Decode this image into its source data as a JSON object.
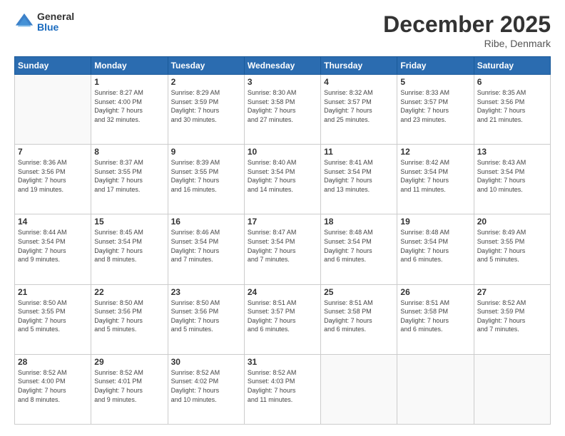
{
  "logo": {
    "general": "General",
    "blue": "Blue"
  },
  "header": {
    "month": "December 2025",
    "location": "Ribe, Denmark"
  },
  "days": [
    "Sunday",
    "Monday",
    "Tuesday",
    "Wednesday",
    "Thursday",
    "Friday",
    "Saturday"
  ],
  "weeks": [
    [
      {
        "day": "",
        "content": ""
      },
      {
        "day": "1",
        "content": "Sunrise: 8:27 AM\nSunset: 4:00 PM\nDaylight: 7 hours\nand 32 minutes."
      },
      {
        "day": "2",
        "content": "Sunrise: 8:29 AM\nSunset: 3:59 PM\nDaylight: 7 hours\nand 30 minutes."
      },
      {
        "day": "3",
        "content": "Sunrise: 8:30 AM\nSunset: 3:58 PM\nDaylight: 7 hours\nand 27 minutes."
      },
      {
        "day": "4",
        "content": "Sunrise: 8:32 AM\nSunset: 3:57 PM\nDaylight: 7 hours\nand 25 minutes."
      },
      {
        "day": "5",
        "content": "Sunrise: 8:33 AM\nSunset: 3:57 PM\nDaylight: 7 hours\nand 23 minutes."
      },
      {
        "day": "6",
        "content": "Sunrise: 8:35 AM\nSunset: 3:56 PM\nDaylight: 7 hours\nand 21 minutes."
      }
    ],
    [
      {
        "day": "7",
        "content": "Sunrise: 8:36 AM\nSunset: 3:56 PM\nDaylight: 7 hours\nand 19 minutes."
      },
      {
        "day": "8",
        "content": "Sunrise: 8:37 AM\nSunset: 3:55 PM\nDaylight: 7 hours\nand 17 minutes."
      },
      {
        "day": "9",
        "content": "Sunrise: 8:39 AM\nSunset: 3:55 PM\nDaylight: 7 hours\nand 16 minutes."
      },
      {
        "day": "10",
        "content": "Sunrise: 8:40 AM\nSunset: 3:54 PM\nDaylight: 7 hours\nand 14 minutes."
      },
      {
        "day": "11",
        "content": "Sunrise: 8:41 AM\nSunset: 3:54 PM\nDaylight: 7 hours\nand 13 minutes."
      },
      {
        "day": "12",
        "content": "Sunrise: 8:42 AM\nSunset: 3:54 PM\nDaylight: 7 hours\nand 11 minutes."
      },
      {
        "day": "13",
        "content": "Sunrise: 8:43 AM\nSunset: 3:54 PM\nDaylight: 7 hours\nand 10 minutes."
      }
    ],
    [
      {
        "day": "14",
        "content": "Sunrise: 8:44 AM\nSunset: 3:54 PM\nDaylight: 7 hours\nand 9 minutes."
      },
      {
        "day": "15",
        "content": "Sunrise: 8:45 AM\nSunset: 3:54 PM\nDaylight: 7 hours\nand 8 minutes."
      },
      {
        "day": "16",
        "content": "Sunrise: 8:46 AM\nSunset: 3:54 PM\nDaylight: 7 hours\nand 7 minutes."
      },
      {
        "day": "17",
        "content": "Sunrise: 8:47 AM\nSunset: 3:54 PM\nDaylight: 7 hours\nand 7 minutes."
      },
      {
        "day": "18",
        "content": "Sunrise: 8:48 AM\nSunset: 3:54 PM\nDaylight: 7 hours\nand 6 minutes."
      },
      {
        "day": "19",
        "content": "Sunrise: 8:48 AM\nSunset: 3:54 PM\nDaylight: 7 hours\nand 6 minutes."
      },
      {
        "day": "20",
        "content": "Sunrise: 8:49 AM\nSunset: 3:55 PM\nDaylight: 7 hours\nand 5 minutes."
      }
    ],
    [
      {
        "day": "21",
        "content": "Sunrise: 8:50 AM\nSunset: 3:55 PM\nDaylight: 7 hours\nand 5 minutes."
      },
      {
        "day": "22",
        "content": "Sunrise: 8:50 AM\nSunset: 3:56 PM\nDaylight: 7 hours\nand 5 minutes."
      },
      {
        "day": "23",
        "content": "Sunrise: 8:50 AM\nSunset: 3:56 PM\nDaylight: 7 hours\nand 5 minutes."
      },
      {
        "day": "24",
        "content": "Sunrise: 8:51 AM\nSunset: 3:57 PM\nDaylight: 7 hours\nand 6 minutes."
      },
      {
        "day": "25",
        "content": "Sunrise: 8:51 AM\nSunset: 3:58 PM\nDaylight: 7 hours\nand 6 minutes."
      },
      {
        "day": "26",
        "content": "Sunrise: 8:51 AM\nSunset: 3:58 PM\nDaylight: 7 hours\nand 6 minutes."
      },
      {
        "day": "27",
        "content": "Sunrise: 8:52 AM\nSunset: 3:59 PM\nDaylight: 7 hours\nand 7 minutes."
      }
    ],
    [
      {
        "day": "28",
        "content": "Sunrise: 8:52 AM\nSunset: 4:00 PM\nDaylight: 7 hours\nand 8 minutes."
      },
      {
        "day": "29",
        "content": "Sunrise: 8:52 AM\nSunset: 4:01 PM\nDaylight: 7 hours\nand 9 minutes."
      },
      {
        "day": "30",
        "content": "Sunrise: 8:52 AM\nSunset: 4:02 PM\nDaylight: 7 hours\nand 10 minutes."
      },
      {
        "day": "31",
        "content": "Sunrise: 8:52 AM\nSunset: 4:03 PM\nDaylight: 7 hours\nand 11 minutes."
      },
      {
        "day": "",
        "content": ""
      },
      {
        "day": "",
        "content": ""
      },
      {
        "day": "",
        "content": ""
      }
    ]
  ]
}
